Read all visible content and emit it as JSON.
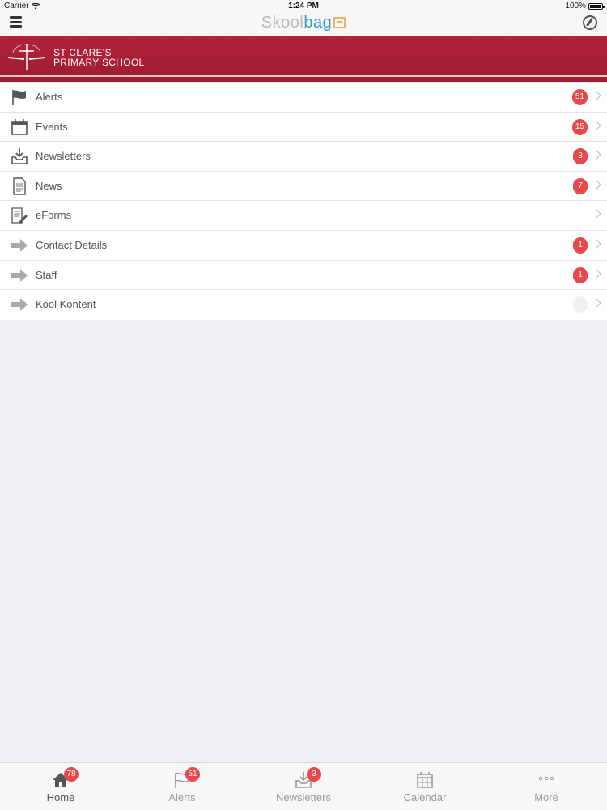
{
  "status_bar": {
    "carrier": "Carrier",
    "time": "1:24 PM",
    "battery": "100%"
  },
  "nav": {
    "brand_part1": "Skool",
    "brand_part2": "bag",
    "menu_icon": "hamburger-icon",
    "sync_icon": "sync-icon"
  },
  "banner": {
    "school_line1": "ST CLARE'S",
    "school_line2": "PRIMARY SCHOOL",
    "color": "#a81f34"
  },
  "menu": {
    "items": [
      {
        "label": "Alerts",
        "icon": "flag-icon",
        "badge": "51"
      },
      {
        "label": "Events",
        "icon": "calendar-icon",
        "badge": "15"
      },
      {
        "label": "Newsletters",
        "icon": "inbox-download-icon",
        "badge": "3"
      },
      {
        "label": "News",
        "icon": "document-icon",
        "badge": "7"
      },
      {
        "label": "eForms",
        "icon": "form-pencil-icon",
        "badge": ""
      },
      {
        "label": "Contact Details",
        "icon": "arrow-right-icon",
        "badge": "1"
      },
      {
        "label": "Staff",
        "icon": "arrow-right-icon",
        "badge": "1"
      },
      {
        "label": "Kool Kontent",
        "icon": "arrow-right-icon",
        "badge": ""
      }
    ]
  },
  "tabs": [
    {
      "label": "Home",
      "icon": "home-icon",
      "badge": "78"
    },
    {
      "label": "Alerts",
      "icon": "flag-icon",
      "badge": "51"
    },
    {
      "label": "Newsletters",
      "icon": "inbox-download-icon",
      "badge": "3"
    },
    {
      "label": "Calendar",
      "icon": "calendar-icon",
      "badge": ""
    },
    {
      "label": "More",
      "icon": "more-dots-icon",
      "badge": ""
    }
  ],
  "colors": {
    "badge": "#e8474b",
    "brand_blue": "#3a9ac4",
    "banner_red": "#a81f34"
  }
}
